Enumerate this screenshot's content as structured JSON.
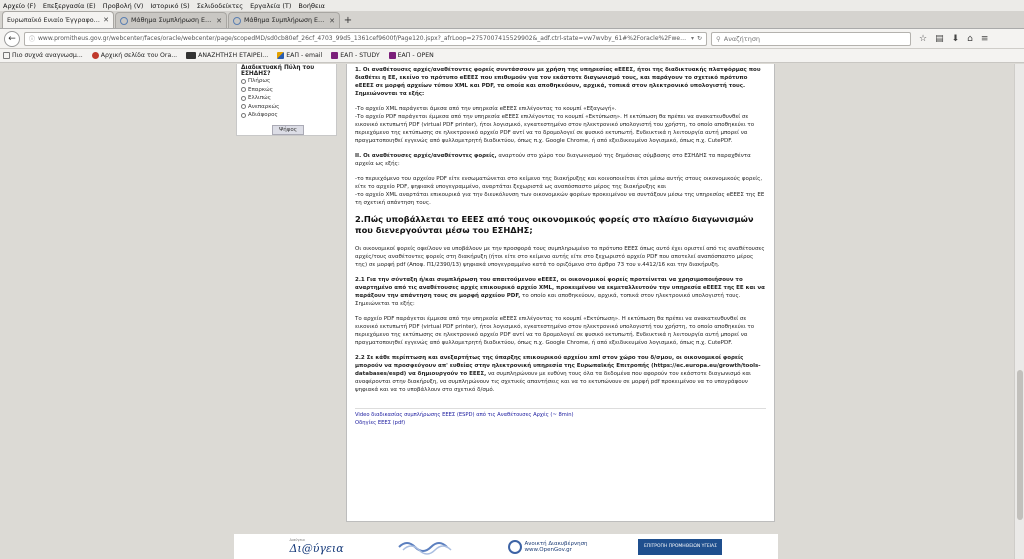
{
  "menu": [
    "Αρχείο (F)",
    "Επεξεργασία (E)",
    "Προβολή (V)",
    "Ιστορικό (S)",
    "Σελιδοδείκτες",
    "Εργαλεία (T)",
    "Βοήθεια"
  ],
  "tabs": [
    {
      "label": "Ευρωπαϊκό Ενιαίο Έγγραφο Σύ..."
    },
    {
      "label": "Μάθημα Συμπλήρωση ΕΕ..."
    },
    {
      "label": "Μάθημα Συμπλήρωση ΕΕ..."
    }
  ],
  "nav": {
    "url": "www.promitheus.gov.gr/webcenter/faces/oracle/webcenter/page/scopedMD/sd0cb80ef_26cf_4703_99d5_1361cef9600f/Page120.jspx?_afrLoop=2757007415529902&_adf.ctrl-state=vw7wvby_61#%2Foracle%2Fwebcenter%2Fpage%2",
    "search_placeholder": "Αναζήτηση"
  },
  "bookmarks": [
    "Πιο συχνά αναγνωσμ...",
    "Αρχική σελίδα του Ora...",
    "ΑΝΑΖΗΤΗΣΗ ΕΤΑΙΡΕΙ...",
    "ΕΑΠ - email",
    "ΕΑΠ - STUDY",
    "ΕΑΠ - OPEN"
  ],
  "poll": {
    "title": "Διαδικτυακή Πύλη του ΕΣΗΔΗΣ?",
    "options": [
      "Πλήρως",
      "Επαρκώς",
      "Ελλιπώς",
      "Ανεπαρκώς",
      "Αδιάφορος"
    ],
    "vote_label": "Ψήφος"
  },
  "content": {
    "p1": "1. Οι αναθέτουσες αρχές/αναθέτοντες φορείς συντάσσουν με χρήση της υπηρεσίας eΕΕΕΣ, ήτοι της διαδικτυακής πλατφόρμας που διαθέτει η ΕΕ, εκείνο το πρότυπο eΕΕΕΣ που επιθυμούν για τον εκάστοτε διαγωνισμό τους, και παράγουν το σχετικό πρότυπο eΕΕΕΣ σε μορφή αρχείων τύπου XML και PDF, τα οποία και αποθηκεύουν, αρχικά, τοπικά στον ηλεκτρονικό υπολογιστή τους. Σημειώνονται τα εξής:",
    "p2": "-Το αρχείο XML παράγεται άμεσα από την υπηρεσία eΕΕΕΣ επιλέγοντας το κουμπί «Εξαγωγή».",
    "p3": "-Το αρχείο PDF παράγεται έμμεσα από την υπηρεσία eΕΕΕΣ επιλέγοντας το κουμπί «Εκτύπωση». Η εκτύπωση θα πρέπει να ανακατευθυνθεί σε εικονικό εκτυπωτή PDF (virtual PDF printer), ήτοι λογισμικό, εγκατεστημένο στον ηλεκτρονικό υπολογιστή του χρήστη, το οποίο αποθηκεύει το περιεχόμενο της εκτύπωσης σε ηλεκτρονικό αρχείο PDF αντί να το δρομολογεί σε φυσικό εκτυπωτή. Ενδεικτικά η λειτουργία αυτή μπορεί να πραγματοποιηθεί εγγενώς από φυλλομετρητή διαδικτύου, όπως π.χ. Google Chrome, ή από εξειδικευμένο λογισμικό, όπως π.χ. CutePDF.",
    "p4_bold": "ΙΙ. Οι αναθέτουσες αρχές/αναθέτοντες φορείς,",
    "p4_rest": " αναρτούν στο χώρο του διαγωνισμού της δημόσιας σύμβασης στο ΕΣΗΔΗΣ τα παραχθέντα αρχεία ως εξής:",
    "p5": "-το περιεχόμενο του αρχείου PDF είτε ενσωματώνεται στο κείμενο της διακήρυξης και κοινοποιείται έτσι μέσω αυτής στους οικονομικούς φορείς, είτε το αρχείο PDF, ψηφιακά υπογεγραμμένο, αναρτάται ξεχωριστά ως αναπόσπαστο μέρος της διακήρυξης και",
    "p6": "-το αρχείο XML αναρτάται επικουρικά για την διευκόλυνση των οικονομικών φορέων προκειμένου να συντάξουν μέσω της υπηρεσίας eΕΕΕΣ της ΕΕ τη σχετική απάντηση τους.",
    "h2": "2.Πώς υποβάλλεται το ΕΕΕΣ από τους οικονομικούς φορείς στο πλαίσιο διαγωνισμών που διενεργούνται μέσω του ΕΣΗΔΗΣ;",
    "p7": "Οι οικονομικοί φορείς οφείλουν να υποβάλουν με την προσφορά τους συμπληρωμένο το πρότυπο ΕΕΕΣ όπως αυτό έχει οριστεί από τις αναθέτουσες αρχές/τους αναθέτοντες φορείς στη διακήρυξη (ήτοι είτε στο κείμενο αυτής είτε στο ξεχωριστό αρχείο PDF που αποτελεί αναπόσπαστο μέρος της) σε μορφή pdf (Αποφ. Π1/2390/13) ψηφιακά υπογεγραμμένο κατά το οριζόμενο στο άρθρο 73 του ν.4412/16 και την διακήρυξη.",
    "p8_bold": "2.1 Για την σύνταξη ή/και συμπλήρωση του απαιτούμενου eΕΕΕΣ, οι οικονομικοί φορείς προτείνεται να χρησιμοποιήσουν το αναρτημένο από τις αναθέτουσες αρχές επικουρικό αρχείο XML, προκειμένου να εκμεταλλευτούν την υπηρεσία eΕΕΕΣ της ΕΕ και να παράξουν την απάντηση τους σε μορφή αρχείου PDF,",
    "p8_rest": " το οποίο και αποθηκεύουν, αρχικά, τοπικά στον ηλεκτρονικό υπολογιστή τους. Σημειώνεται τα εξής:",
    "p9": "Το αρχείο PDF παράγεται έμμεσα από την υπηρεσία eΕΕΕΣ επιλέγοντας το κουμπί «Εκτύπωση». Η εκτύπωση θα πρέπει να ανακατευθυνθεί σε εικονικό εκτυπωτή PDF (virtual PDF printer), ήτοι λογισμικό, εγκατεστημένο στον ηλεκτρονικό υπολογιστή του χρήστη, το οποίο αποθηκεύει το περιεχόμενο της εκτύπωσης σε ηλεκτρονικό αρχείο PDF αντί να το δρομολογεί σε φυσικό εκτυπωτή. Ενδεικτικά η λειτουργία αυτή μπορεί να πραγματοποιηθεί εγγενώς από φυλλομετρητή διαδικτύου, όπως π.χ. Google Chrome, ή από εξειδικευμένο λογισμικό, όπως π.χ. CutePDF.",
    "p10_bold": "2.2 Σε κάθε περίπτωση και ανεξαρτήτως της ύπαρξης επικουρικού αρχείου xml στον χώρο του δ/σμου, οι οικονομικοί φορείς μπορούν να προσφεύγουν απ' ευθείας στην ηλεκτρονική υπηρεσία της Ευρωπαϊκής Επιτροπής (https://ec.europa.eu/growth/tools-databases/espd) να δημιουργούν το ΕΕΕΣ,",
    "p10_rest": " να συμπληρώνουν με ευθύνη τους όλα τα δεδομένα που αφορούν τον εκάστοτε διαγωνισμό και αναφέρονται στην διακήρυξη, να συμπληρώνουν τις σχετικές απαντήσεις και να το εκτυπώνουν σε μορφή pdf προκειμένου να το υπογράφουν ψηφιακά και να το υποβάλλουν στο σχετικό δ/σμό.",
    "link1": "Video διαδικασίας συμπλήρωσης ΕΕΕΣ (ESPD) από τις Αναθέτουσες Αρχές (~ 8min)",
    "link2": "Οδηγίες ΕΕΕΣ (pdf)"
  },
  "footer": {
    "logo1_small": "Διαύγεια",
    "logo1_big": "Δι@ύγεια",
    "logo3_line1": "Ανοικτή Διακυβέρνηση",
    "logo3_line2": "www.OpenGov.gr",
    "logo4": "ΕΠΙΤΡΟΠΗ ΠΡΟΜΗΘΕΙΩΝ ΥΓΕΙΑΣ"
  }
}
